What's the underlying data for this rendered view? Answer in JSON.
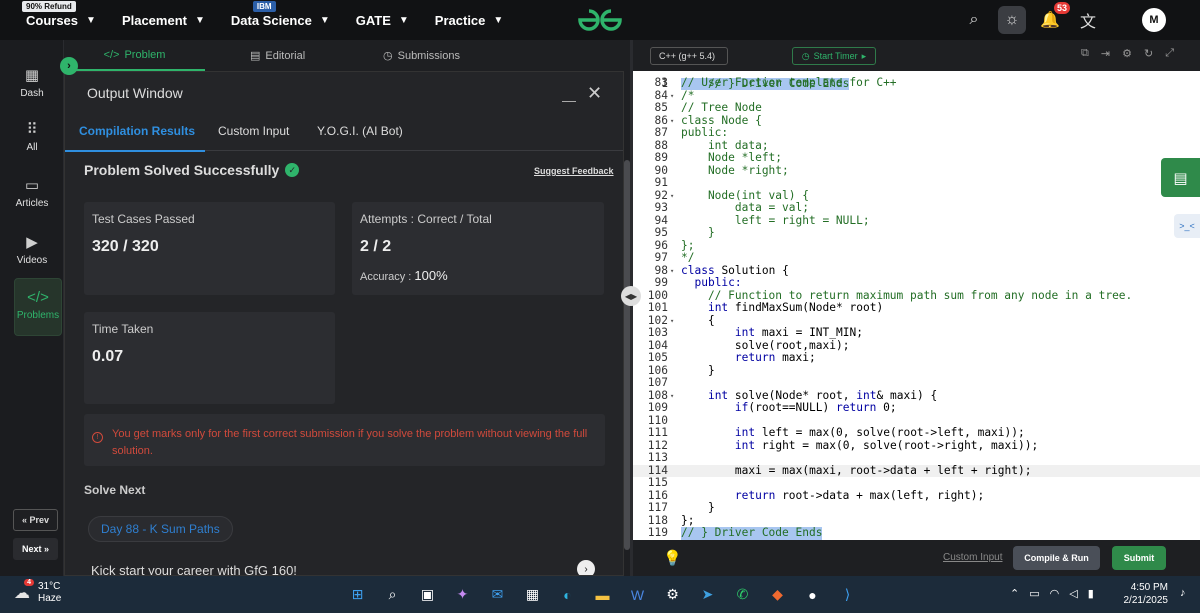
{
  "nav": {
    "items": [
      {
        "label": "Courses",
        "badge": "90% Refund"
      },
      {
        "label": "Placement"
      },
      {
        "label": "Data Science",
        "badge": "IBM"
      },
      {
        "label": "GATE"
      },
      {
        "label": "Practice"
      }
    ],
    "notifications": "53",
    "avatar": "M"
  },
  "sidebar": {
    "items": [
      "Dash",
      "All",
      "Articles",
      "Videos",
      "Problems"
    ],
    "prev": "« Prev",
    "next": "Next »"
  },
  "problem_tabs": [
    "Problem",
    "Editorial",
    "Submissions"
  ],
  "output": {
    "title": "Output Window",
    "tabs": [
      "Compilation Results",
      "Custom Input",
      "Y.O.G.I. (AI Bot)"
    ],
    "status": "Problem Solved Successfully",
    "feedback": "Suggest Feedback",
    "test_cases_label": "Test Cases Passed",
    "test_cases_value": "320 / 320",
    "attempts_label": "Attempts : Correct / Total",
    "attempts_value": "2 / 2",
    "accuracy_label": "Accuracy :",
    "accuracy_value": "100%",
    "time_label": "Time Taken",
    "time_value": "0.07",
    "warning": "You get marks only for the first correct submission if you solve the problem without viewing the full solution.",
    "solve_next": "Solve Next",
    "next_problem": "Day 88 - K Sum Paths",
    "kick": "Kick start your career with GfG 160!"
  },
  "editor": {
    "language": "C++ (g++ 5.4)",
    "timer": "Start Timer",
    "lines": [
      {
        "n": "83",
        "t": "// User Fuction template for C++",
        "cls": "c-cm"
      },
      {
        "n": "84",
        "t": "/*",
        "cls": "c-cm",
        "fold": true
      },
      {
        "n": "85",
        "t": "// Tree Node",
        "cls": "c-cm"
      },
      {
        "n": "86",
        "t": "class Node {",
        "cls": "c-cm",
        "fold": true
      },
      {
        "n": "87",
        "t": "public:",
        "cls": "c-cm"
      },
      {
        "n": "88",
        "t": "    int data;",
        "cls": "c-cm"
      },
      {
        "n": "89",
        "t": "    Node *left;",
        "cls": "c-cm"
      },
      {
        "n": "90",
        "t": "    Node *right;",
        "cls": "c-cm"
      },
      {
        "n": "91",
        "t": "",
        "cls": "c-cm"
      },
      {
        "n": "92",
        "t": "    Node(int val) {",
        "cls": "c-cm",
        "fold": true
      },
      {
        "n": "93",
        "t": "        data = val;",
        "cls": "c-cm"
      },
      {
        "n": "94",
        "t": "        left = right = NULL;",
        "cls": "c-cm"
      },
      {
        "n": "95",
        "t": "    }",
        "cls": "c-cm"
      },
      {
        "n": "96",
        "t": "};",
        "cls": "c-cm"
      },
      {
        "n": "97",
        "t": "*/",
        "cls": "c-cm"
      },
      {
        "n": "98",
        "t": "class Solution {",
        "cls": "",
        "fold": true
      },
      {
        "n": "99",
        "t": "  public:",
        "cls": ""
      },
      {
        "n": "100",
        "t": "    // Function to return maximum path sum from any node in a tree.",
        "cls": "c-cm"
      },
      {
        "n": "101",
        "t": "    int findMaxSum(Node* root)",
        "cls": ""
      },
      {
        "n": "102",
        "t": "    {",
        "cls": "",
        "fold": true
      },
      {
        "n": "103",
        "t": "        int maxi = INT_MIN;",
        "cls": ""
      },
      {
        "n": "104",
        "t": "        solve(root,maxi);",
        "cls": ""
      },
      {
        "n": "105",
        "t": "        return maxi;",
        "cls": ""
      },
      {
        "n": "106",
        "t": "    }",
        "cls": ""
      },
      {
        "n": "107",
        "t": "",
        "cls": ""
      },
      {
        "n": "108",
        "t": "    int solve(Node* root, int& maxi) {",
        "cls": "",
        "fold": true
      },
      {
        "n": "109",
        "t": "        if(root==NULL) return 0;",
        "cls": ""
      },
      {
        "n": "110",
        "t": "",
        "cls": ""
      },
      {
        "n": "111",
        "t": "        int left = max(0, solve(root->left, maxi));",
        "cls": ""
      },
      {
        "n": "112",
        "t": "        int right = max(0, solve(root->right, maxi));",
        "cls": ""
      },
      {
        "n": "113",
        "t": "",
        "cls": ""
      },
      {
        "n": "114",
        "t": "        maxi = max(maxi, root->data + left + right);",
        "cls": "",
        "hl": true
      },
      {
        "n": "115",
        "t": "",
        "cls": ""
      },
      {
        "n": "116",
        "t": "        return root->data + max(left, right);",
        "cls": ""
      },
      {
        "n": "117",
        "t": "    }",
        "cls": ""
      },
      {
        "n": "118",
        "t": "};",
        "cls": ""
      },
      {
        "n": "119",
        "t": "// } Driver Code Ends",
        "cls": "c-sel"
      }
    ],
    "custom_input": "Custom Input",
    "compile": "Compile & Run",
    "submit": "Submit"
  },
  "taskbar": {
    "temp": "31°C",
    "weather": "Haze",
    "weather_badge": "4",
    "time": "4:50 PM",
    "date": "2/21/2025"
  }
}
